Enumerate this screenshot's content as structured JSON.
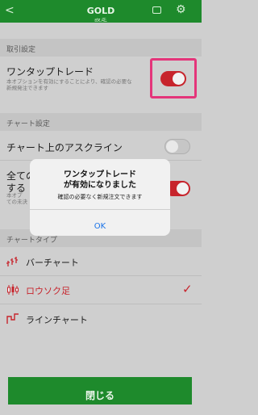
{
  "topbar": {
    "back_glyph": "<",
    "title": "GOLD",
    "subtitle": "設定"
  },
  "sections": {
    "trade": "取引設定",
    "chart": "チャート設定",
    "chart_type": "チャートタイプ"
  },
  "one_tap": {
    "title": "ワンタップトレード",
    "desc_line1": "本オプションを有効にすることにより、確認の必要な",
    "desc_line2": "新規発注できます",
    "enabled": true
  },
  "ask_line": {
    "title": "チャート上のアスクライン",
    "enabled": false
  },
  "all_row": {
    "title_line1": "全ての",
    "title_line2": "する",
    "desc_line1": "本オプ",
    "desc_line2": "ての未決",
    "enabled": true
  },
  "chart_types": [
    {
      "label": "バーチャート",
      "selected": false,
      "icon": "bar-chart-icon"
    },
    {
      "label": "ロウソク足",
      "selected": true,
      "icon": "candlestick-icon"
    },
    {
      "label": "ラインチャート",
      "selected": false,
      "icon": "line-chart-icon"
    }
  ],
  "checkmark": "✓",
  "close_button": "閉じる",
  "dialog": {
    "title_line1": "ワンタップトレード",
    "title_line2": "が有効になりました",
    "message": "確認の必要なく新規注文できます",
    "ok": "OK"
  },
  "colors": {
    "brand_green": "#1e8a2c",
    "toggle_on": "#c7242c",
    "highlight": "#e4357a",
    "link_blue": "#1a73e8"
  }
}
